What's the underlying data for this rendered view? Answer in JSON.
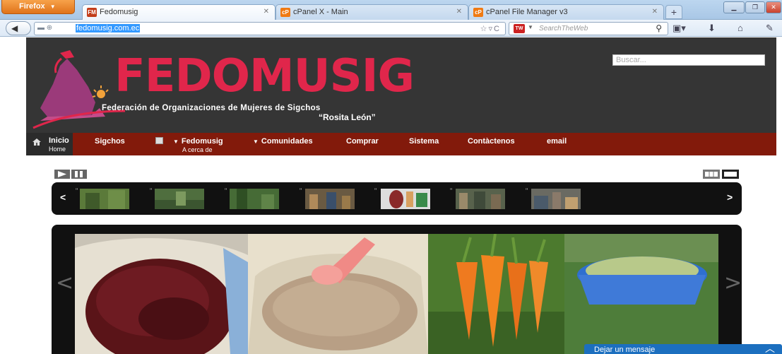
{
  "browser": {
    "menu_button": "Firefox",
    "tabs": [
      {
        "title": "Fedomusig",
        "favicon": "FM",
        "active": true
      },
      {
        "title": "cPanel X - Main",
        "favicon": "cP",
        "active": false
      },
      {
        "title": "cPanel File Manager v3",
        "favicon": "cP",
        "active": false
      }
    ],
    "new_tab": "+",
    "url": "fedomusig.com.ec",
    "search_placeholder": "SearchTheWeb",
    "search_engine_badge": "TW"
  },
  "site": {
    "title": "FEDOMUSIG",
    "subtitle": "Federación de Organizaciones de Mujeres de Sigchos",
    "subtitle2": "“Rosita León”",
    "search_placeholder": "Buscar...",
    "accent_color": "#e0264b",
    "menu_color": "#821a0b"
  },
  "menu": {
    "home": {
      "label": "Inicio",
      "sub": "Home"
    },
    "sigchos": "Sigchos",
    "fedomusig": {
      "label": "Fedomusig",
      "sub": "A cerca de"
    },
    "comunidades": "Comunidades",
    "comprar": "Comprar",
    "sistema": "Sistema",
    "contactenos": "Contàctenos",
    "email": "email"
  },
  "slider": {
    "prev": "<",
    "next": ">",
    "big_prev": "<",
    "big_next": ">",
    "thumbnail_count": 7
  },
  "chat": {
    "label": "Dejar un mensaje"
  }
}
